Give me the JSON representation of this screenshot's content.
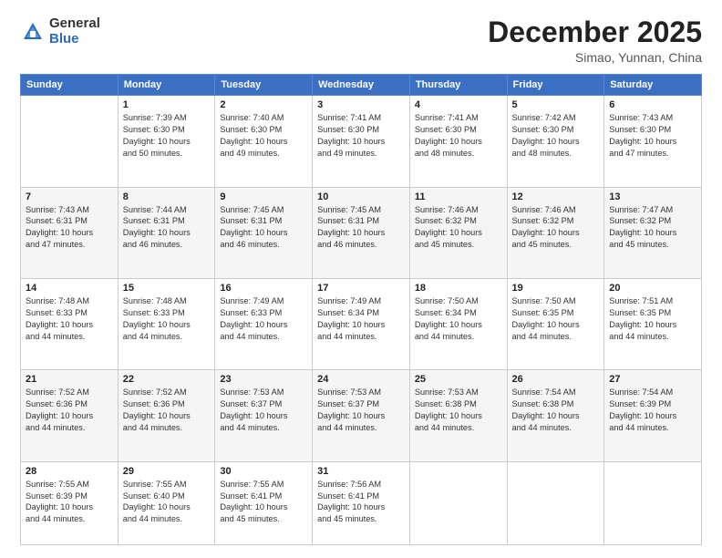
{
  "logo": {
    "general": "General",
    "blue": "Blue"
  },
  "title": "December 2025",
  "subtitle": "Simao, Yunnan, China",
  "days_of_week": [
    "Sunday",
    "Monday",
    "Tuesday",
    "Wednesday",
    "Thursday",
    "Friday",
    "Saturday"
  ],
  "weeks": [
    [
      {
        "num": "",
        "info": ""
      },
      {
        "num": "1",
        "info": "Sunrise: 7:39 AM\nSunset: 6:30 PM\nDaylight: 10 hours\nand 50 minutes."
      },
      {
        "num": "2",
        "info": "Sunrise: 7:40 AM\nSunset: 6:30 PM\nDaylight: 10 hours\nand 49 minutes."
      },
      {
        "num": "3",
        "info": "Sunrise: 7:41 AM\nSunset: 6:30 PM\nDaylight: 10 hours\nand 49 minutes."
      },
      {
        "num": "4",
        "info": "Sunrise: 7:41 AM\nSunset: 6:30 PM\nDaylight: 10 hours\nand 48 minutes."
      },
      {
        "num": "5",
        "info": "Sunrise: 7:42 AM\nSunset: 6:30 PM\nDaylight: 10 hours\nand 48 minutes."
      },
      {
        "num": "6",
        "info": "Sunrise: 7:43 AM\nSunset: 6:30 PM\nDaylight: 10 hours\nand 47 minutes."
      }
    ],
    [
      {
        "num": "7",
        "info": "Sunrise: 7:43 AM\nSunset: 6:31 PM\nDaylight: 10 hours\nand 47 minutes."
      },
      {
        "num": "8",
        "info": "Sunrise: 7:44 AM\nSunset: 6:31 PM\nDaylight: 10 hours\nand 46 minutes."
      },
      {
        "num": "9",
        "info": "Sunrise: 7:45 AM\nSunset: 6:31 PM\nDaylight: 10 hours\nand 46 minutes."
      },
      {
        "num": "10",
        "info": "Sunrise: 7:45 AM\nSunset: 6:31 PM\nDaylight: 10 hours\nand 46 minutes."
      },
      {
        "num": "11",
        "info": "Sunrise: 7:46 AM\nSunset: 6:32 PM\nDaylight: 10 hours\nand 45 minutes."
      },
      {
        "num": "12",
        "info": "Sunrise: 7:46 AM\nSunset: 6:32 PM\nDaylight: 10 hours\nand 45 minutes."
      },
      {
        "num": "13",
        "info": "Sunrise: 7:47 AM\nSunset: 6:32 PM\nDaylight: 10 hours\nand 45 minutes."
      }
    ],
    [
      {
        "num": "14",
        "info": "Sunrise: 7:48 AM\nSunset: 6:33 PM\nDaylight: 10 hours\nand 44 minutes."
      },
      {
        "num": "15",
        "info": "Sunrise: 7:48 AM\nSunset: 6:33 PM\nDaylight: 10 hours\nand 44 minutes."
      },
      {
        "num": "16",
        "info": "Sunrise: 7:49 AM\nSunset: 6:33 PM\nDaylight: 10 hours\nand 44 minutes."
      },
      {
        "num": "17",
        "info": "Sunrise: 7:49 AM\nSunset: 6:34 PM\nDaylight: 10 hours\nand 44 minutes."
      },
      {
        "num": "18",
        "info": "Sunrise: 7:50 AM\nSunset: 6:34 PM\nDaylight: 10 hours\nand 44 minutes."
      },
      {
        "num": "19",
        "info": "Sunrise: 7:50 AM\nSunset: 6:35 PM\nDaylight: 10 hours\nand 44 minutes."
      },
      {
        "num": "20",
        "info": "Sunrise: 7:51 AM\nSunset: 6:35 PM\nDaylight: 10 hours\nand 44 minutes."
      }
    ],
    [
      {
        "num": "21",
        "info": "Sunrise: 7:52 AM\nSunset: 6:36 PM\nDaylight: 10 hours\nand 44 minutes."
      },
      {
        "num": "22",
        "info": "Sunrise: 7:52 AM\nSunset: 6:36 PM\nDaylight: 10 hours\nand 44 minutes."
      },
      {
        "num": "23",
        "info": "Sunrise: 7:53 AM\nSunset: 6:37 PM\nDaylight: 10 hours\nand 44 minutes."
      },
      {
        "num": "24",
        "info": "Sunrise: 7:53 AM\nSunset: 6:37 PM\nDaylight: 10 hours\nand 44 minutes."
      },
      {
        "num": "25",
        "info": "Sunrise: 7:53 AM\nSunset: 6:38 PM\nDaylight: 10 hours\nand 44 minutes."
      },
      {
        "num": "26",
        "info": "Sunrise: 7:54 AM\nSunset: 6:38 PM\nDaylight: 10 hours\nand 44 minutes."
      },
      {
        "num": "27",
        "info": "Sunrise: 7:54 AM\nSunset: 6:39 PM\nDaylight: 10 hours\nand 44 minutes."
      }
    ],
    [
      {
        "num": "28",
        "info": "Sunrise: 7:55 AM\nSunset: 6:39 PM\nDaylight: 10 hours\nand 44 minutes."
      },
      {
        "num": "29",
        "info": "Sunrise: 7:55 AM\nSunset: 6:40 PM\nDaylight: 10 hours\nand 44 minutes."
      },
      {
        "num": "30",
        "info": "Sunrise: 7:55 AM\nSunset: 6:41 PM\nDaylight: 10 hours\nand 45 minutes."
      },
      {
        "num": "31",
        "info": "Sunrise: 7:56 AM\nSunset: 6:41 PM\nDaylight: 10 hours\nand 45 minutes."
      },
      {
        "num": "",
        "info": ""
      },
      {
        "num": "",
        "info": ""
      },
      {
        "num": "",
        "info": ""
      }
    ]
  ]
}
